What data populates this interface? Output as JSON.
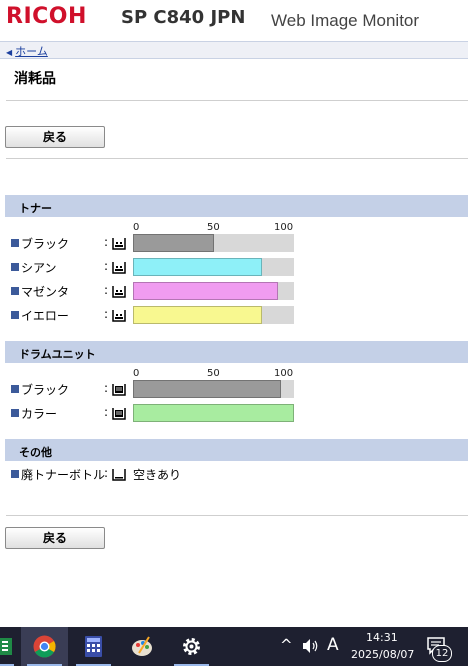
{
  "header": {
    "brand": "RICOH",
    "model": "SP C840 JPN",
    "product": "Web Image Monitor"
  },
  "breadcrumb": {
    "home": "ホーム"
  },
  "page": {
    "title": "消耗品",
    "back_label": "戻る"
  },
  "scale": {
    "t0": "0",
    "t50": "50",
    "t100": "100"
  },
  "colon": ":",
  "toner": {
    "heading": "トナー",
    "items": [
      {
        "label": "ブラック",
        "level_percent": 50,
        "color": "#9a9a9a"
      },
      {
        "label": "シアン",
        "level_percent": 80,
        "color": "#8ef0f8"
      },
      {
        "label": "マゼンタ",
        "level_percent": 90,
        "color": "#f09cf0"
      },
      {
        "label": "イエロー",
        "level_percent": 80,
        "color": "#f8f890"
      }
    ]
  },
  "drum": {
    "heading": "ドラムユニット",
    "items": [
      {
        "label": "ブラック",
        "level_percent": 92,
        "color": "#9a9a9a"
      },
      {
        "label": "カラー",
        "level_percent": 100,
        "color": "#a8eca0"
      }
    ]
  },
  "other": {
    "heading": "その他",
    "waste_label": "廃トナーボトル",
    "waste_status": "空きあり"
  },
  "taskbar": {
    "time": "14:31",
    "date": "2025/08/07",
    "ime": "A",
    "notification_count": "12",
    "apps": [
      "excel-icon",
      "chrome-icon",
      "calculator-icon",
      "paint-icon",
      "settings-icon"
    ]
  },
  "colors": {
    "section_bg": "#c4d0e7",
    "link": "#1b3f9e",
    "taskbar_bg": "#1e2030"
  }
}
